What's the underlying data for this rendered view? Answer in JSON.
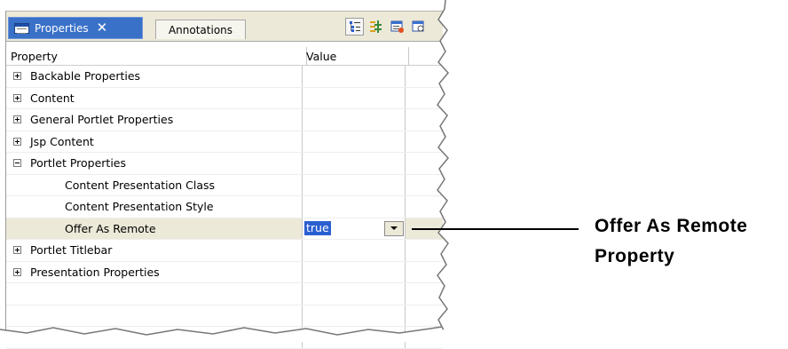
{
  "tabs": {
    "active": {
      "label": "Properties",
      "icon": "properties-view-icon",
      "close_icon": "close-icon"
    },
    "inactive": {
      "label": "Annotations"
    }
  },
  "toolbar": {
    "buttons": [
      {
        "icon": "show-categories-icon"
      },
      {
        "icon": "show-advanced-properties-icon"
      },
      {
        "icon": "restore-default-icon"
      },
      {
        "icon": "view-menu-icon"
      }
    ]
  },
  "table": {
    "columns": {
      "property": "Property",
      "value": "Value"
    },
    "rows": [
      {
        "label": "Backable Properties",
        "expander": "plus"
      },
      {
        "label": "Content",
        "expander": "plus"
      },
      {
        "label": "General Portlet Properties",
        "expander": "plus"
      },
      {
        "label": "Jsp Content",
        "expander": "plus"
      },
      {
        "label": "Portlet Properties",
        "expander": "minus"
      },
      {
        "label": "Content Presentation Class",
        "child": true
      },
      {
        "label": "Content Presentation Style",
        "child": true
      },
      {
        "label": "Offer As Remote",
        "child": true,
        "selected": true,
        "value": "true"
      },
      {
        "label": "Portlet Titlebar",
        "expander": "plus"
      },
      {
        "label": "Presentation Properties",
        "expander": "plus"
      }
    ]
  },
  "callout": {
    "line1": "Offer As Remote",
    "line2": "Property"
  },
  "colors": {
    "tab_active": "#3a71c8",
    "selection": "#2a5fd0",
    "selected_row": "#ece9d8"
  }
}
